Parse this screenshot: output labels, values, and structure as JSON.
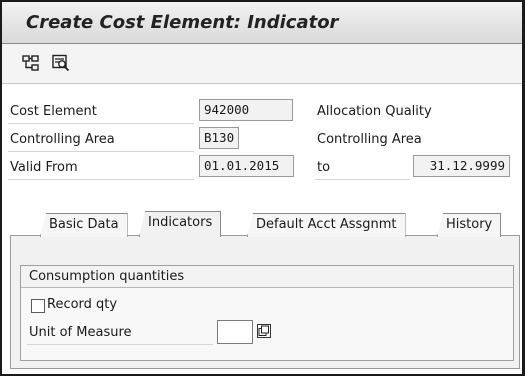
{
  "window": {
    "title": "Create Cost Element: Indicator"
  },
  "toolbar": {
    "icons": [
      "hierarchy-icon",
      "display-icon"
    ]
  },
  "header": {
    "cost_element_label": "Cost Element",
    "cost_element_value": "942000",
    "allocation_quality_label": "Allocation Quality",
    "controlling_area_label": "Controlling Area",
    "controlling_area_value": "B130",
    "controlling_area_right_label": "Controlling Area",
    "valid_from_label": "Valid From",
    "valid_from_value": "01.01.2015",
    "to_label": "to",
    "valid_to_value": "31.12.9999"
  },
  "tabs": [
    {
      "label": "Basic Data",
      "active": false
    },
    {
      "label": "Indicators",
      "active": true
    },
    {
      "label": "Default Acct Assgnmt",
      "active": false
    },
    {
      "label": "History",
      "active": false
    }
  ],
  "indicators": {
    "group_title": "Consumption quantities",
    "record_qty_label": "Record qty",
    "record_qty_checked": false,
    "unit_of_measure_label": "Unit of Measure",
    "unit_of_measure_value": ""
  }
}
